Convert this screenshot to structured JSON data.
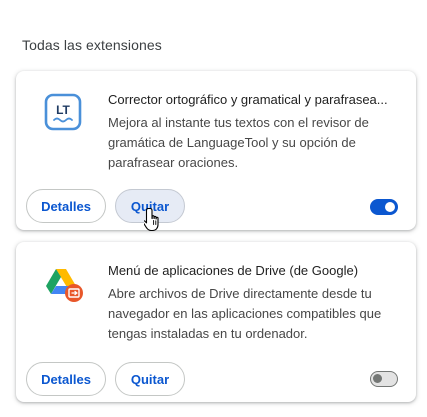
{
  "section": {
    "title": "Todas las extensiones"
  },
  "extensions": [
    {
      "icon": "languagetool-icon",
      "name": "Corrector ortográfico y gramatical y parafrasea...",
      "description": "Mejora al instante tus textos con el revisor de gramática de LanguageTool y su opción de parafrasear oraciones.",
      "details_label": "Detalles",
      "remove_label": "Quitar",
      "enabled": true
    },
    {
      "icon": "google-drive-apps-icon",
      "name": "Menú de aplicaciones de Drive (de Google)",
      "description": "Abre archivos de Drive directamente desde tu navegador en las aplicaciones compatibles que tengas instaladas en tu ordenador.",
      "details_label": "Detalles",
      "remove_label": "Quitar",
      "enabled": false
    }
  ],
  "colors": {
    "accent": "#0b57d0",
    "toggle_on": "#0b57d0",
    "toggle_off_track": "#e3e3e3",
    "toggle_off_knob": "#747775",
    "hover_button": "#e6ebf5",
    "languagetool_blue": "#4a90d9",
    "drive_green": "#1ea362",
    "drive_yellow": "#ffba00",
    "drive_blue": "#4285f4",
    "badge_red": "#e8572a"
  }
}
